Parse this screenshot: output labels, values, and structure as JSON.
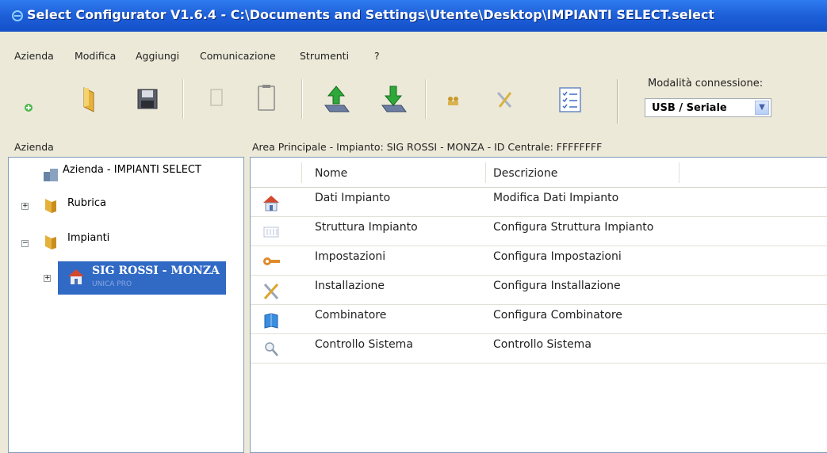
{
  "window": {
    "title": "Select Configurator V1.6.4 - C:\\Documents and Settings\\Utente\\Desktop\\IMPIANTI SELECT.select"
  },
  "menu": [
    {
      "label": "Azienda"
    },
    {
      "label": "Modifica"
    },
    {
      "label": "Aggiungi"
    },
    {
      "label": "Comunicazione"
    },
    {
      "label": "Strumenti"
    },
    {
      "label": "?"
    }
  ],
  "toolbar": {
    "buttons": [
      {
        "icon": "new-icon"
      },
      {
        "icon": "open-folder-icon"
      },
      {
        "icon": "save-icon"
      },
      {
        "icon": "copy-icon"
      },
      {
        "icon": "paste-icon"
      },
      {
        "icon": "upload-icon"
      },
      {
        "icon": "download-icon"
      },
      {
        "icon": "users-icon"
      },
      {
        "icon": "tools-icon"
      },
      {
        "icon": "checklist-icon"
      }
    ],
    "connection_label": "Modalità connessione:",
    "connection_value": "USB / Seriale"
  },
  "left_panel": {
    "header": "Azienda",
    "tree": {
      "root": "Azienda - IMPIANTI SELECT",
      "rubrica": "Rubrica",
      "impianti": "Impianti",
      "selected_title": "SIG ROSSI - MONZA",
      "selected_subtitle": "UNICA PRO"
    }
  },
  "right_panel": {
    "header": "Area Principale - Impianto: SIG ROSSI - MONZA - ID Centrale: FFFFFFFF",
    "columns": [
      "Nome",
      "Descrizione"
    ],
    "rows": [
      {
        "name": "Dati Impianto",
        "description": "Modifica Dati Impianto",
        "icon": "house-icon"
      },
      {
        "name": "Struttura Impianto",
        "description": "Configura Struttura Impianto",
        "icon": "structure-icon"
      },
      {
        "name": "Impostazioni",
        "description": "Configura Impostazioni",
        "icon": "key-icon"
      },
      {
        "name": "Installazione",
        "description": "Configura Installazione",
        "icon": "tools-icon"
      },
      {
        "name": "Combinatore",
        "description": "Configura Combinatore",
        "icon": "book-icon"
      },
      {
        "name": "Controllo Sistema",
        "description": "Controllo Sistema",
        "icon": "magnifier-icon"
      }
    ]
  },
  "colors": {
    "titlebar": "#1d5fd8",
    "selection": "#316ac5",
    "background": "#ece9d8"
  }
}
